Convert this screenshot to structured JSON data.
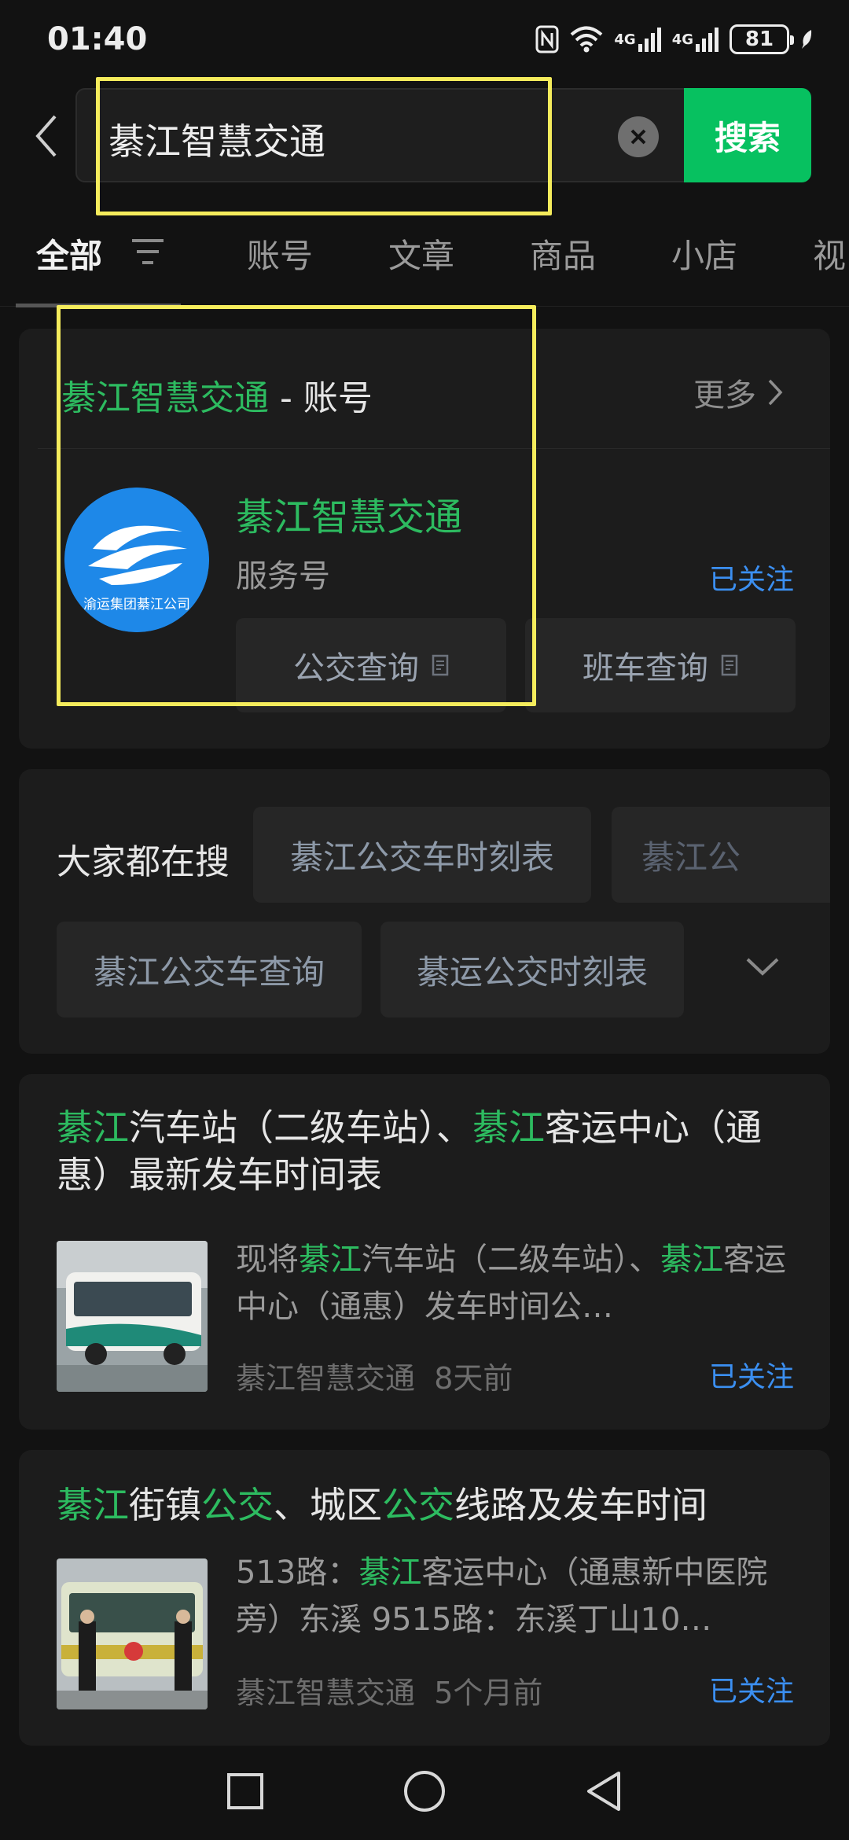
{
  "status_bar": {
    "time": "01:40",
    "net1": "4G",
    "net2": "4G",
    "battery": "81"
  },
  "search": {
    "value": "綦江智慧交通",
    "button_label": "搜索"
  },
  "tabs": [
    {
      "label": "全部"
    },
    {
      "label": "账号"
    },
    {
      "label": "文章"
    },
    {
      "label": "商品"
    },
    {
      "label": "小店"
    },
    {
      "label": "视"
    }
  ],
  "account_section": {
    "header_highlight": "綦江智慧交通",
    "header_rest": " - 账号",
    "more_label": "更多",
    "account_name": "綦江智慧交通",
    "account_type": "服务号",
    "follow_status": "已关注",
    "logo_text": "渝运集团綦江公司",
    "services": [
      {
        "label": "公交查询"
      },
      {
        "label": "班车查询"
      }
    ]
  },
  "hot_searches": {
    "label": "大家都在搜",
    "chips": [
      {
        "label": "綦江公交车时刻表"
      },
      {
        "label": "綦江公"
      },
      {
        "label": "綦江公交车查询"
      },
      {
        "label": "綦运公交时刻表"
      }
    ]
  },
  "articles": [
    {
      "title_parts": [
        "綦江",
        "汽车站（二级车站）、",
        "綦江",
        "客运中心（通惠）最新发车时间表"
      ],
      "desc_parts": [
        "现将",
        "綦江",
        "汽车站（二级车站）、",
        "綦江",
        "客运中心（通惠）发车时间公…"
      ],
      "source": "綦江智慧交通",
      "time": "8天前",
      "follow_status": "已关注"
    },
    {
      "title_parts": [
        "綦江",
        "街镇",
        "公交",
        "、城区",
        "公交",
        "线路及发车时间"
      ],
      "desc_parts": [
        "513路：",
        "綦江",
        "客运中心（通惠新中医院旁）东溪 9515路：东溪丁山10…"
      ],
      "source": "綦江智慧交通",
      "time": "5个月前",
      "follow_status": "已关注"
    }
  ],
  "colors": {
    "accent_green": "#07c160",
    "highlight_green": "#2dbb60",
    "link_blue": "#3b8ff1",
    "annotation_yellow": "#f5ec5c"
  }
}
